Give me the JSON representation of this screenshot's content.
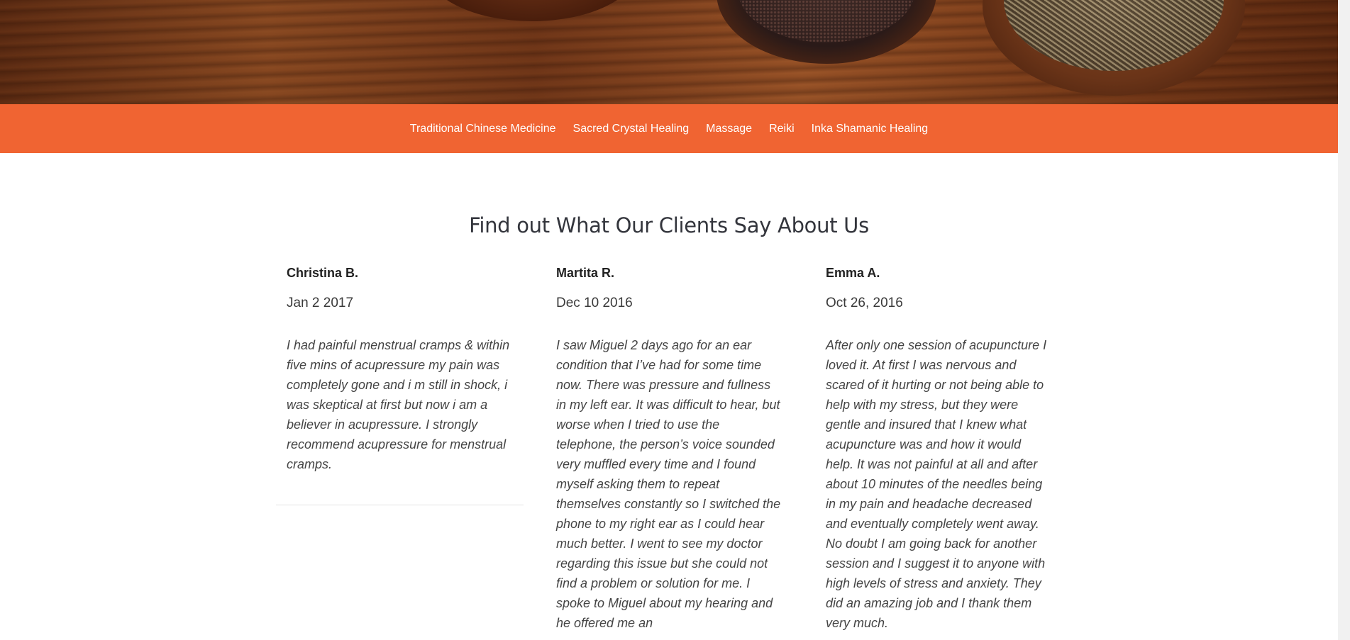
{
  "nav": {
    "items": [
      {
        "label": "Traditional Chinese Medicine"
      },
      {
        "label": "Sacred Crystal Healing"
      },
      {
        "label": "Massage"
      },
      {
        "label": "Reiki"
      },
      {
        "label": "Inka Shamanic Healing"
      }
    ]
  },
  "testimonials_section": {
    "title": "Find out What Our Clients Say About Us",
    "items": [
      {
        "name": "Christina B.",
        "date": "Jan 2 2017",
        "text": "I had painful menstrual cramps & within five mins of acupressure my pain was completely gone and i m still in shock, i was skeptical at first but now i am a believer in acupressure. I strongly recommend acupressure for menstrual cramps."
      },
      {
        "name": "Martita R.",
        "date": "Dec 10 2016",
        "text": "I saw Miguel 2 days ago for an ear condition that I’ve had for some time now. There was pressure and fullness in my left ear. It was difficult to hear, but worse when I tried to use the telephone, the person’s voice sounded very muffled every time and I found myself asking them to repeat themselves constantly so I switched the phone to my right ear as I could hear much better. I went to see my doctor regarding this issue but she could not find a problem or solution for me. I spoke to Miguel about my hearing and he offered me an"
      },
      {
        "name": "Emma A.",
        "date": "Oct 26, 2016",
        "text": "After only one session of acupuncture I loved it. At first I was nervous and scared of it hurting or not being able to help with my stress, but they were gentle and insured that I knew what acupuncture was and how it would help. It was not painful at all and after about 10 minutes of the needles being in my pain and headache decreased and eventually completely went away. No doubt I am going back for another session and I suggest it to anyone with high levels of stress and anxiety. They did an amazing job and I thank them very much."
      }
    ]
  }
}
